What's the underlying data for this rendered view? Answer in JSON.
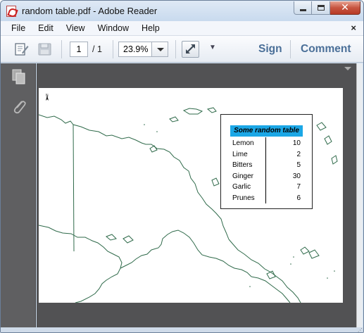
{
  "window": {
    "title": "random table.pdf - Adobe Reader"
  },
  "menu": {
    "items": [
      "File",
      "Edit",
      "View",
      "Window",
      "Help"
    ],
    "close_glyph": "×"
  },
  "toolbar": {
    "page_current": "1",
    "page_total": "/ 1",
    "zoom": "23.9%",
    "more_glyph": "▼",
    "sign_label": "Sign",
    "comment_label": "Comment"
  },
  "icons": {
    "create": "create-pdf-icon",
    "save": "save-disk-icon",
    "fit": "fit-page-icon",
    "pages": "pages-panel-icon",
    "attachments": "paperclip-icon"
  },
  "document": {
    "north_label": "N",
    "table": {
      "title": "Some random table",
      "rows": [
        {
          "label": "Lemon",
          "value": "10"
        },
        {
          "label": "Lime",
          "value": "2"
        },
        {
          "label": "Bitters",
          "value": "5"
        },
        {
          "label": "Ginger",
          "value": "30"
        },
        {
          "label": "Garlic",
          "value": "7"
        },
        {
          "label": "Prunes",
          "value": "6"
        }
      ]
    }
  },
  "colors": {
    "map_line": "#2f6a4a",
    "table_header": "#1ba7e6",
    "link": "#4a6f98",
    "doc_background": "#525254"
  }
}
